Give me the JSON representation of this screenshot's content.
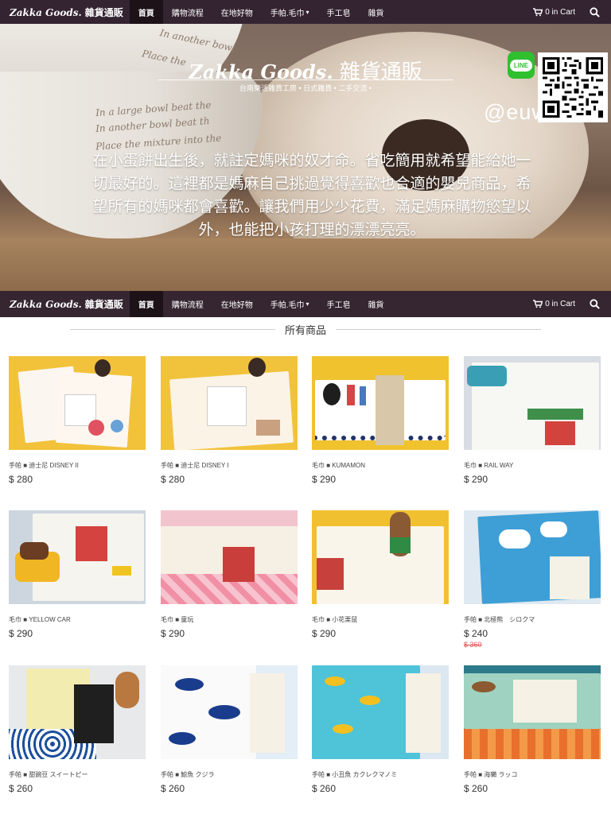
{
  "nav": {
    "brand_script": "Zakka Goods.",
    "brand_text": "雜貨通販",
    "items": [
      "首頁",
      "購物流程",
      "在地好物",
      "手帕.毛巾",
      "手工皂",
      "雜貨"
    ],
    "dropdown_caret": "▾",
    "cart_label": "0 in Cart"
  },
  "hero": {
    "title_script": "Zakka Goods.",
    "title_text": "雜貨通販",
    "subtitle": "台南樂活雜貨工房 • 日式雜貨 • 二手交流 •",
    "handle": "@euw8121i",
    "line_label": "LINE",
    "description": "在小蛋餅出生後，就註定媽咪的奴才命。省吃簡用就希望能給她一切最好的。這裡都是媽麻自己挑過覺得喜歡也合適的嬰兒商品，希望所有的媽咪都會喜歡。讓我們用少少花費，滿足媽麻購物慾望以外，也能把小孩打理的漂漂亮亮。",
    "bowl_text": [
      "Place the",
      "In another bowl",
      "In a large bowl beat the",
      "In another bowl beat th",
      "Place the mixture into the"
    ]
  },
  "section": {
    "title": "所有商品"
  },
  "products": [
    {
      "name": "手帕 ■ 迪士尼 DISNEY II",
      "price": "$ 280",
      "old_price": ""
    },
    {
      "name": "手帕 ■ 迪士尼 DISNEY I",
      "price": "$ 280",
      "old_price": ""
    },
    {
      "name": "毛巾 ■ KUMAMON",
      "price": "$ 290",
      "old_price": ""
    },
    {
      "name": "毛巾 ■ RAIL WAY",
      "price": "$ 290",
      "old_price": ""
    },
    {
      "name": "毛巾 ■ YELLOW CAR",
      "price": "$ 290",
      "old_price": ""
    },
    {
      "name": "毛巾 ■ 童玩",
      "price": "$ 290",
      "old_price": ""
    },
    {
      "name": "毛巾 ■ 小花栗鼠",
      "price": "$ 290",
      "old_price": ""
    },
    {
      "name": "手帕 ■ 北極熊　シロクマ",
      "price": "$ 240",
      "old_price": "$ 360"
    },
    {
      "name": "手帕 ■ 甜豌豆 スイートピー",
      "price": "$ 260",
      "old_price": ""
    },
    {
      "name": "手帕 ■ 鯨魚 クジラ",
      "price": "$ 260",
      "old_price": ""
    },
    {
      "name": "手帕 ■ 小丑魚 カクレクマノミ",
      "price": "$ 260",
      "old_price": ""
    },
    {
      "name": "手帕 ■ 海獺 ラッコ",
      "price": "$ 260",
      "old_price": ""
    }
  ],
  "colors": {
    "navbar": "#342432",
    "navbar_active": "#1c1218",
    "sale": "#d9534f"
  }
}
